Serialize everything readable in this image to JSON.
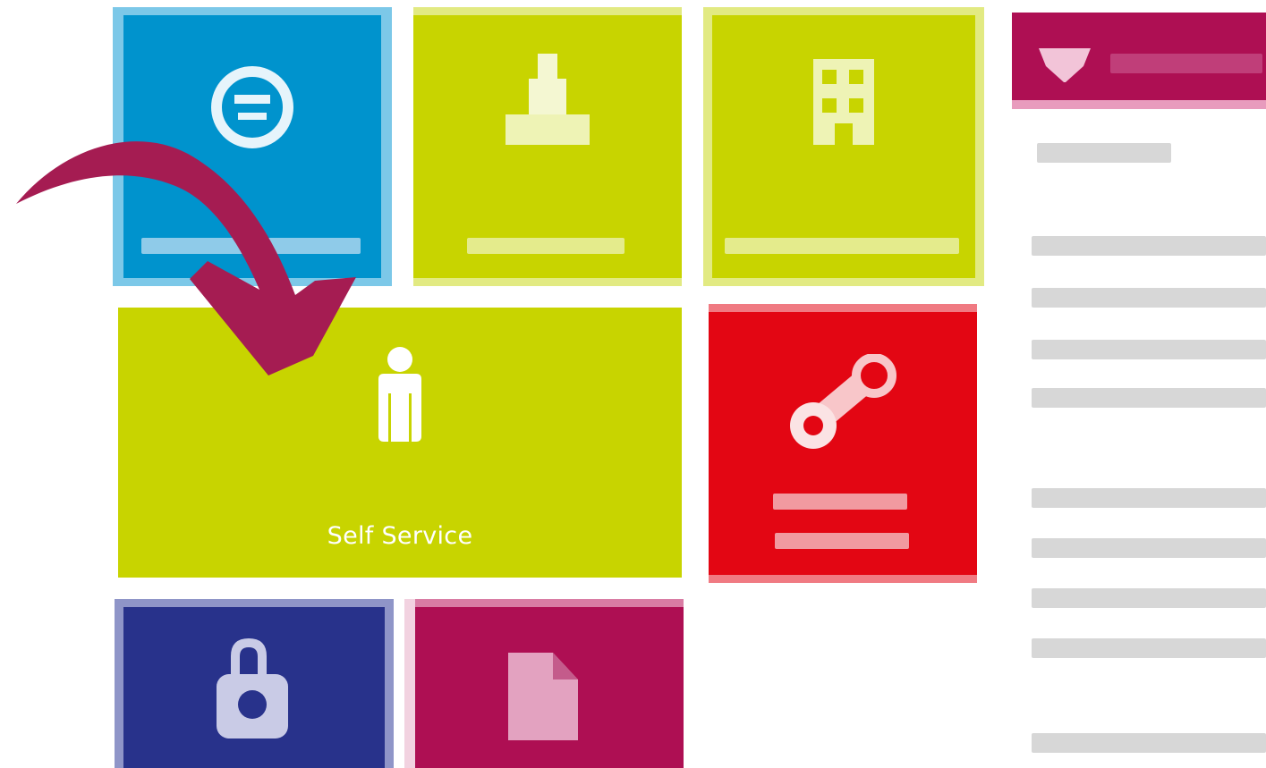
{
  "tiles": [
    {
      "id": "mijn-aanvragen",
      "label": "",
      "color": "#0093cd",
      "icon": "smiley-icon"
    },
    {
      "id": "mijn-dossier",
      "label": "",
      "color": "#c8d400",
      "icon": "person-podium-icon"
    },
    {
      "id": "servicedossier",
      "label": "",
      "color": "#c8d400",
      "icon": "building-icon"
    },
    {
      "id": "self-service",
      "label": "Self Service",
      "color": "#c8d400",
      "icon": "person-icon"
    },
    {
      "id": "wijzig-wachtwoord",
      "label": "",
      "color": "#e30613",
      "icon": "key-icon"
    },
    {
      "id": "blue-tile",
      "label": "",
      "color": "#28328b",
      "icon": "padlock-icon"
    },
    {
      "id": "magenta-tile",
      "label": "",
      "color": "#ae0f53",
      "icon": "document-icon"
    }
  ],
  "colors": {
    "lime": "#c8d400",
    "blue": "#0093cd",
    "red": "#e30613",
    "navy": "#28328b",
    "magenta": "#ae0f53",
    "arrow": "#a51c52"
  },
  "panel": {
    "header_title": "",
    "greeting": "",
    "paragraphs": []
  },
  "annotation": {
    "arrow_icon": "curved-arrow-icon",
    "points_to": "self-service"
  }
}
